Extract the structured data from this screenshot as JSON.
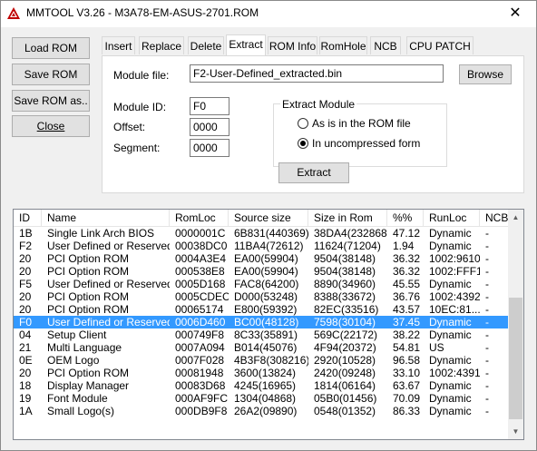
{
  "window": {
    "title": "MMTOOL V3.26 - M3A78-EM-ASUS-2701.ROM",
    "close_glyph": "✕"
  },
  "sidebar": {
    "load_rom": "Load ROM",
    "save_rom": "Save ROM",
    "save_rom_as": "Save ROM as..",
    "close": "Close"
  },
  "tabs": [
    "Insert",
    "Replace",
    "Delete",
    "Extract",
    "ROM Info",
    "RomHole",
    "NCB",
    "CPU PATCH"
  ],
  "active_tab": "Extract",
  "extract": {
    "module_file_label": "Module file:",
    "module_file_value": "F2-User-Defined_extracted.bin",
    "browse": "Browse",
    "module_id_label": "Module ID:",
    "module_id_value": "F0",
    "offset_label": "Offset:",
    "offset_value": "0000",
    "segment_label": "Segment:",
    "segment_value": "0000",
    "group_title": "Extract Module",
    "option_as_is": "As is in the ROM file",
    "option_uncompressed": "In uncompressed form",
    "selected_option": "uncompressed",
    "extract_button": "Extract"
  },
  "table": {
    "columns": [
      "ID",
      "Name",
      "RomLoc",
      "Source size",
      "Size in Rom",
      "%%",
      "RunLoc",
      "NCB"
    ],
    "selected_index": 7,
    "rows": [
      [
        "1B",
        "Single Link Arch BIOS",
        "0000001C",
        "6B831(440369)",
        "38DA4(232868)",
        "47.12",
        "Dynamic",
        "-"
      ],
      [
        "F2",
        "User Defined or Reserved",
        "00038DC0",
        "11BA4(72612)",
        "11624(71204)",
        "1.94",
        "Dynamic",
        "-"
      ],
      [
        "20",
        "PCI Option ROM",
        "0004A3E4",
        "EA00(59904)",
        "9504(38148)",
        "36.32",
        "1002:9610",
        "-"
      ],
      [
        "20",
        "PCI Option ROM",
        "000538E8",
        "EA00(59904)",
        "9504(38148)",
        "36.32",
        "1002:FFF1",
        "-"
      ],
      [
        "F5",
        "User Defined or Reserved",
        "0005D168",
        "FAC8(64200)",
        "8890(34960)",
        "45.55",
        "Dynamic",
        "-"
      ],
      [
        "20",
        "PCI Option ROM",
        "0005CDEC",
        "D000(53248)",
        "8388(33672)",
        "36.76",
        "1002:4392",
        "-"
      ],
      [
        "20",
        "PCI Option ROM",
        "00065174",
        "E800(59392)",
        "82EC(33516)",
        "43.57",
        "10EC:81...",
        "-"
      ],
      [
        "F0",
        "User Defined or Reserved",
        "0006D460",
        "BC00(48128)",
        "7598(30104)",
        "37.45",
        "Dynamic",
        "-"
      ],
      [
        "04",
        "Setup Client",
        "000749F8",
        "8C33(35891)",
        "569C(22172)",
        "38.22",
        "Dynamic",
        "-"
      ],
      [
        "21",
        "Multi Language",
        "0007A094",
        "B014(45076)",
        "4F94(20372)",
        "54.81",
        "US",
        "-"
      ],
      [
        "0E",
        "OEM Logo",
        "0007F028",
        "4B3F8(308216)",
        "2920(10528)",
        "96.58",
        "Dynamic",
        "-"
      ],
      [
        "20",
        "PCI Option ROM",
        "00081948",
        "3600(13824)",
        "2420(09248)",
        "33.10",
        "1002:4391",
        "-"
      ],
      [
        "18",
        "Display Manager",
        "00083D68",
        "4245(16965)",
        "1814(06164)",
        "63.67",
        "Dynamic",
        "-"
      ],
      [
        "19",
        "Font Module",
        "000AF9FC",
        "1304(04868)",
        "05B0(01456)",
        "70.09",
        "Dynamic",
        "-"
      ],
      [
        "1A",
        "Small Logo(s)",
        "000DB9F8",
        "26A2(09890)",
        "0548(01352)",
        "86.33",
        "Dynamic",
        "-"
      ]
    ]
  },
  "colors": {
    "selection": "#3399ff",
    "accent_border": "#0078d7"
  }
}
